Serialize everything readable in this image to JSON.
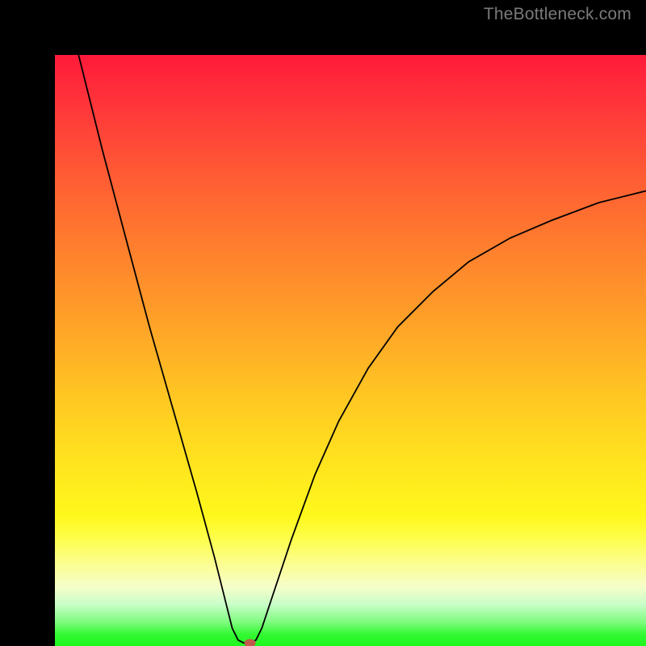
{
  "watermark": "TheBottleneck.com",
  "chart_data": {
    "type": "line",
    "title": "",
    "xlabel": "",
    "ylabel": "",
    "xlim": [
      0,
      100
    ],
    "ylim": [
      0,
      100
    ],
    "grid": false,
    "legend": false,
    "annotations": [],
    "gradient_stops": [
      {
        "pos": 0,
        "color": "#ff1a3a"
      },
      {
        "pos": 10,
        "color": "#ff3a3a"
      },
      {
        "pos": 20,
        "color": "#ff5a34"
      },
      {
        "pos": 32,
        "color": "#ff7d2e"
      },
      {
        "pos": 45,
        "color": "#ffa128"
      },
      {
        "pos": 58,
        "color": "#ffc722"
      },
      {
        "pos": 70,
        "color": "#ffe61e"
      },
      {
        "pos": 78,
        "color": "#fff81c"
      },
      {
        "pos": 82,
        "color": "#fdfe4e"
      },
      {
        "pos": 86,
        "color": "#fbfe8f"
      },
      {
        "pos": 90,
        "color": "#f6feca"
      },
      {
        "pos": 93,
        "color": "#c8fec8"
      },
      {
        "pos": 96,
        "color": "#7dfb7d"
      },
      {
        "pos": 98,
        "color": "#34f934"
      },
      {
        "pos": 100,
        "color": "#1cf71c"
      }
    ],
    "series": [
      {
        "name": "bottleneck-curve",
        "points": [
          {
            "x": 4,
            "y": 100
          },
          {
            "x": 8,
            "y": 84
          },
          {
            "x": 12,
            "y": 69
          },
          {
            "x": 16,
            "y": 54
          },
          {
            "x": 20,
            "y": 40
          },
          {
            "x": 24,
            "y": 26
          },
          {
            "x": 27,
            "y": 15
          },
          {
            "x": 29,
            "y": 7
          },
          {
            "x": 30,
            "y": 3
          },
          {
            "x": 31,
            "y": 1
          },
          {
            "x": 32,
            "y": 0.5
          },
          {
            "x": 33,
            "y": 0.5
          },
          {
            "x": 34,
            "y": 1
          },
          {
            "x": 35,
            "y": 3
          },
          {
            "x": 37,
            "y": 9
          },
          {
            "x": 40,
            "y": 18
          },
          {
            "x": 44,
            "y": 29
          },
          {
            "x": 48,
            "y": 38
          },
          {
            "x": 53,
            "y": 47
          },
          {
            "x": 58,
            "y": 54
          },
          {
            "x": 64,
            "y": 60
          },
          {
            "x": 70,
            "y": 65
          },
          {
            "x": 77,
            "y": 69
          },
          {
            "x": 84,
            "y": 72
          },
          {
            "x": 92,
            "y": 75
          },
          {
            "x": 100,
            "y": 77
          }
        ]
      }
    ],
    "marker": {
      "x": 33,
      "y": 0.5,
      "color": "#c05a4a"
    }
  }
}
